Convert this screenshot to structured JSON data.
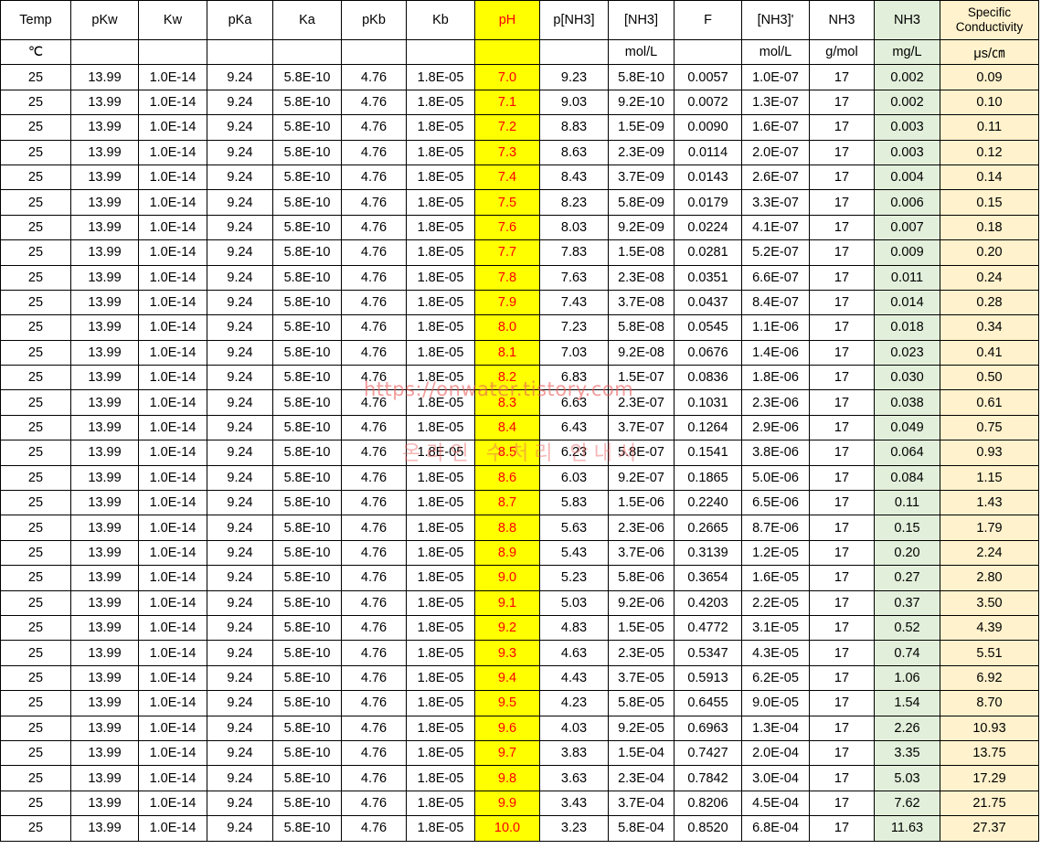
{
  "headers": [
    "Temp",
    "pKw",
    "Kw",
    "pKa",
    "Ka",
    "pKb",
    "Kb",
    "pH",
    "p[NH3]",
    "[NH3]",
    "F",
    "[NH3]'",
    "NH3",
    "NH3",
    "Specific Conductivity"
  ],
  "units": [
    "℃",
    "",
    "",
    "",
    "",
    "",
    "",
    "",
    "",
    "mol/L",
    "",
    "mol/L",
    "g/mol",
    "mg/L",
    "μs/㎝"
  ],
  "rows": [
    [
      "25",
      "13.99",
      "1.0E-14",
      "9.24",
      "5.8E-10",
      "4.76",
      "1.8E-05",
      "7.0",
      "9.23",
      "5.8E-10",
      "0.0057",
      "1.0E-07",
      "17",
      "0.002",
      "0.09"
    ],
    [
      "25",
      "13.99",
      "1.0E-14",
      "9.24",
      "5.8E-10",
      "4.76",
      "1.8E-05",
      "7.1",
      "9.03",
      "9.2E-10",
      "0.0072",
      "1.3E-07",
      "17",
      "0.002",
      "0.10"
    ],
    [
      "25",
      "13.99",
      "1.0E-14",
      "9.24",
      "5.8E-10",
      "4.76",
      "1.8E-05",
      "7.2",
      "8.83",
      "1.5E-09",
      "0.0090",
      "1.6E-07",
      "17",
      "0.003",
      "0.11"
    ],
    [
      "25",
      "13.99",
      "1.0E-14",
      "9.24",
      "5.8E-10",
      "4.76",
      "1.8E-05",
      "7.3",
      "8.63",
      "2.3E-09",
      "0.0114",
      "2.0E-07",
      "17",
      "0.003",
      "0.12"
    ],
    [
      "25",
      "13.99",
      "1.0E-14",
      "9.24",
      "5.8E-10",
      "4.76",
      "1.8E-05",
      "7.4",
      "8.43",
      "3.7E-09",
      "0.0143",
      "2.6E-07",
      "17",
      "0.004",
      "0.14"
    ],
    [
      "25",
      "13.99",
      "1.0E-14",
      "9.24",
      "5.8E-10",
      "4.76",
      "1.8E-05",
      "7.5",
      "8.23",
      "5.8E-09",
      "0.0179",
      "3.3E-07",
      "17",
      "0.006",
      "0.15"
    ],
    [
      "25",
      "13.99",
      "1.0E-14",
      "9.24",
      "5.8E-10",
      "4.76",
      "1.8E-05",
      "7.6",
      "8.03",
      "9.2E-09",
      "0.0224",
      "4.1E-07",
      "17",
      "0.007",
      "0.18"
    ],
    [
      "25",
      "13.99",
      "1.0E-14",
      "9.24",
      "5.8E-10",
      "4.76",
      "1.8E-05",
      "7.7",
      "7.83",
      "1.5E-08",
      "0.0281",
      "5.2E-07",
      "17",
      "0.009",
      "0.20"
    ],
    [
      "25",
      "13.99",
      "1.0E-14",
      "9.24",
      "5.8E-10",
      "4.76",
      "1.8E-05",
      "7.8",
      "7.63",
      "2.3E-08",
      "0.0351",
      "6.6E-07",
      "17",
      "0.011",
      "0.24"
    ],
    [
      "25",
      "13.99",
      "1.0E-14",
      "9.24",
      "5.8E-10",
      "4.76",
      "1.8E-05",
      "7.9",
      "7.43",
      "3.7E-08",
      "0.0437",
      "8.4E-07",
      "17",
      "0.014",
      "0.28"
    ],
    [
      "25",
      "13.99",
      "1.0E-14",
      "9.24",
      "5.8E-10",
      "4.76",
      "1.8E-05",
      "8.0",
      "7.23",
      "5.8E-08",
      "0.0545",
      "1.1E-06",
      "17",
      "0.018",
      "0.34"
    ],
    [
      "25",
      "13.99",
      "1.0E-14",
      "9.24",
      "5.8E-10",
      "4.76",
      "1.8E-05",
      "8.1",
      "7.03",
      "9.2E-08",
      "0.0676",
      "1.4E-06",
      "17",
      "0.023",
      "0.41"
    ],
    [
      "25",
      "13.99",
      "1.0E-14",
      "9.24",
      "5.8E-10",
      "4.76",
      "1.8E-05",
      "8.2",
      "6.83",
      "1.5E-07",
      "0.0836",
      "1.8E-06",
      "17",
      "0.030",
      "0.50"
    ],
    [
      "25",
      "13.99",
      "1.0E-14",
      "9.24",
      "5.8E-10",
      "4.76",
      "1.8E-05",
      "8.3",
      "6.63",
      "2.3E-07",
      "0.1031",
      "2.3E-06",
      "17",
      "0.038",
      "0.61"
    ],
    [
      "25",
      "13.99",
      "1.0E-14",
      "9.24",
      "5.8E-10",
      "4.76",
      "1.8E-05",
      "8.4",
      "6.43",
      "3.7E-07",
      "0.1264",
      "2.9E-06",
      "17",
      "0.049",
      "0.75"
    ],
    [
      "25",
      "13.99",
      "1.0E-14",
      "9.24",
      "5.8E-10",
      "4.76",
      "1.8E-05",
      "8.5",
      "6.23",
      "5.8E-07",
      "0.1541",
      "3.8E-06",
      "17",
      "0.064",
      "0.93"
    ],
    [
      "25",
      "13.99",
      "1.0E-14",
      "9.24",
      "5.8E-10",
      "4.76",
      "1.8E-05",
      "8.6",
      "6.03",
      "9.2E-07",
      "0.1865",
      "5.0E-06",
      "17",
      "0.084",
      "1.15"
    ],
    [
      "25",
      "13.99",
      "1.0E-14",
      "9.24",
      "5.8E-10",
      "4.76",
      "1.8E-05",
      "8.7",
      "5.83",
      "1.5E-06",
      "0.2240",
      "6.5E-06",
      "17",
      "0.11",
      "1.43"
    ],
    [
      "25",
      "13.99",
      "1.0E-14",
      "9.24",
      "5.8E-10",
      "4.76",
      "1.8E-05",
      "8.8",
      "5.63",
      "2.3E-06",
      "0.2665",
      "8.7E-06",
      "17",
      "0.15",
      "1.79"
    ],
    [
      "25",
      "13.99",
      "1.0E-14",
      "9.24",
      "5.8E-10",
      "4.76",
      "1.8E-05",
      "8.9",
      "5.43",
      "3.7E-06",
      "0.3139",
      "1.2E-05",
      "17",
      "0.20",
      "2.24"
    ],
    [
      "25",
      "13.99",
      "1.0E-14",
      "9.24",
      "5.8E-10",
      "4.76",
      "1.8E-05",
      "9.0",
      "5.23",
      "5.8E-06",
      "0.3654",
      "1.6E-05",
      "17",
      "0.27",
      "2.80"
    ],
    [
      "25",
      "13.99",
      "1.0E-14",
      "9.24",
      "5.8E-10",
      "4.76",
      "1.8E-05",
      "9.1",
      "5.03",
      "9.2E-06",
      "0.4203",
      "2.2E-05",
      "17",
      "0.37",
      "3.50"
    ],
    [
      "25",
      "13.99",
      "1.0E-14",
      "9.24",
      "5.8E-10",
      "4.76",
      "1.8E-05",
      "9.2",
      "4.83",
      "1.5E-05",
      "0.4772",
      "3.1E-05",
      "17",
      "0.52",
      "4.39"
    ],
    [
      "25",
      "13.99",
      "1.0E-14",
      "9.24",
      "5.8E-10",
      "4.76",
      "1.8E-05",
      "9.3",
      "4.63",
      "2.3E-05",
      "0.5347",
      "4.3E-05",
      "17",
      "0.74",
      "5.51"
    ],
    [
      "25",
      "13.99",
      "1.0E-14",
      "9.24",
      "5.8E-10",
      "4.76",
      "1.8E-05",
      "9.4",
      "4.43",
      "3.7E-05",
      "0.5913",
      "6.2E-05",
      "17",
      "1.06",
      "6.92"
    ],
    [
      "25",
      "13.99",
      "1.0E-14",
      "9.24",
      "5.8E-10",
      "4.76",
      "1.8E-05",
      "9.5",
      "4.23",
      "5.8E-05",
      "0.6455",
      "9.0E-05",
      "17",
      "1.54",
      "8.70"
    ],
    [
      "25",
      "13.99",
      "1.0E-14",
      "9.24",
      "5.8E-10",
      "4.76",
      "1.8E-05",
      "9.6",
      "4.03",
      "9.2E-05",
      "0.6963",
      "1.3E-04",
      "17",
      "2.26",
      "10.93"
    ],
    [
      "25",
      "13.99",
      "1.0E-14",
      "9.24",
      "5.8E-10",
      "4.76",
      "1.8E-05",
      "9.7",
      "3.83",
      "1.5E-04",
      "0.7427",
      "2.0E-04",
      "17",
      "3.35",
      "13.75"
    ],
    [
      "25",
      "13.99",
      "1.0E-14",
      "9.24",
      "5.8E-10",
      "4.76",
      "1.8E-05",
      "9.8",
      "3.63",
      "2.3E-04",
      "0.7842",
      "3.0E-04",
      "17",
      "5.03",
      "17.29"
    ],
    [
      "25",
      "13.99",
      "1.0E-14",
      "9.24",
      "5.8E-10",
      "4.76",
      "1.8E-05",
      "9.9",
      "3.43",
      "3.7E-04",
      "0.8206",
      "4.5E-04",
      "17",
      "7.62",
      "21.75"
    ],
    [
      "25",
      "13.99",
      "1.0E-14",
      "9.24",
      "5.8E-10",
      "4.76",
      "1.8E-05",
      "10.0",
      "3.23",
      "5.8E-04",
      "0.8520",
      "6.8E-04",
      "17",
      "11.63",
      "27.37"
    ]
  ],
  "watermark": {
    "url": "https://onwater.tistory.com",
    "name": "온라인 수처리 안내서"
  },
  "colors": {
    "ph_fill": "#ffff00",
    "ph_text": "#ff0000",
    "nh3_mg_fill": "#e2efda",
    "conductivity_fill": "#fff2cc"
  }
}
